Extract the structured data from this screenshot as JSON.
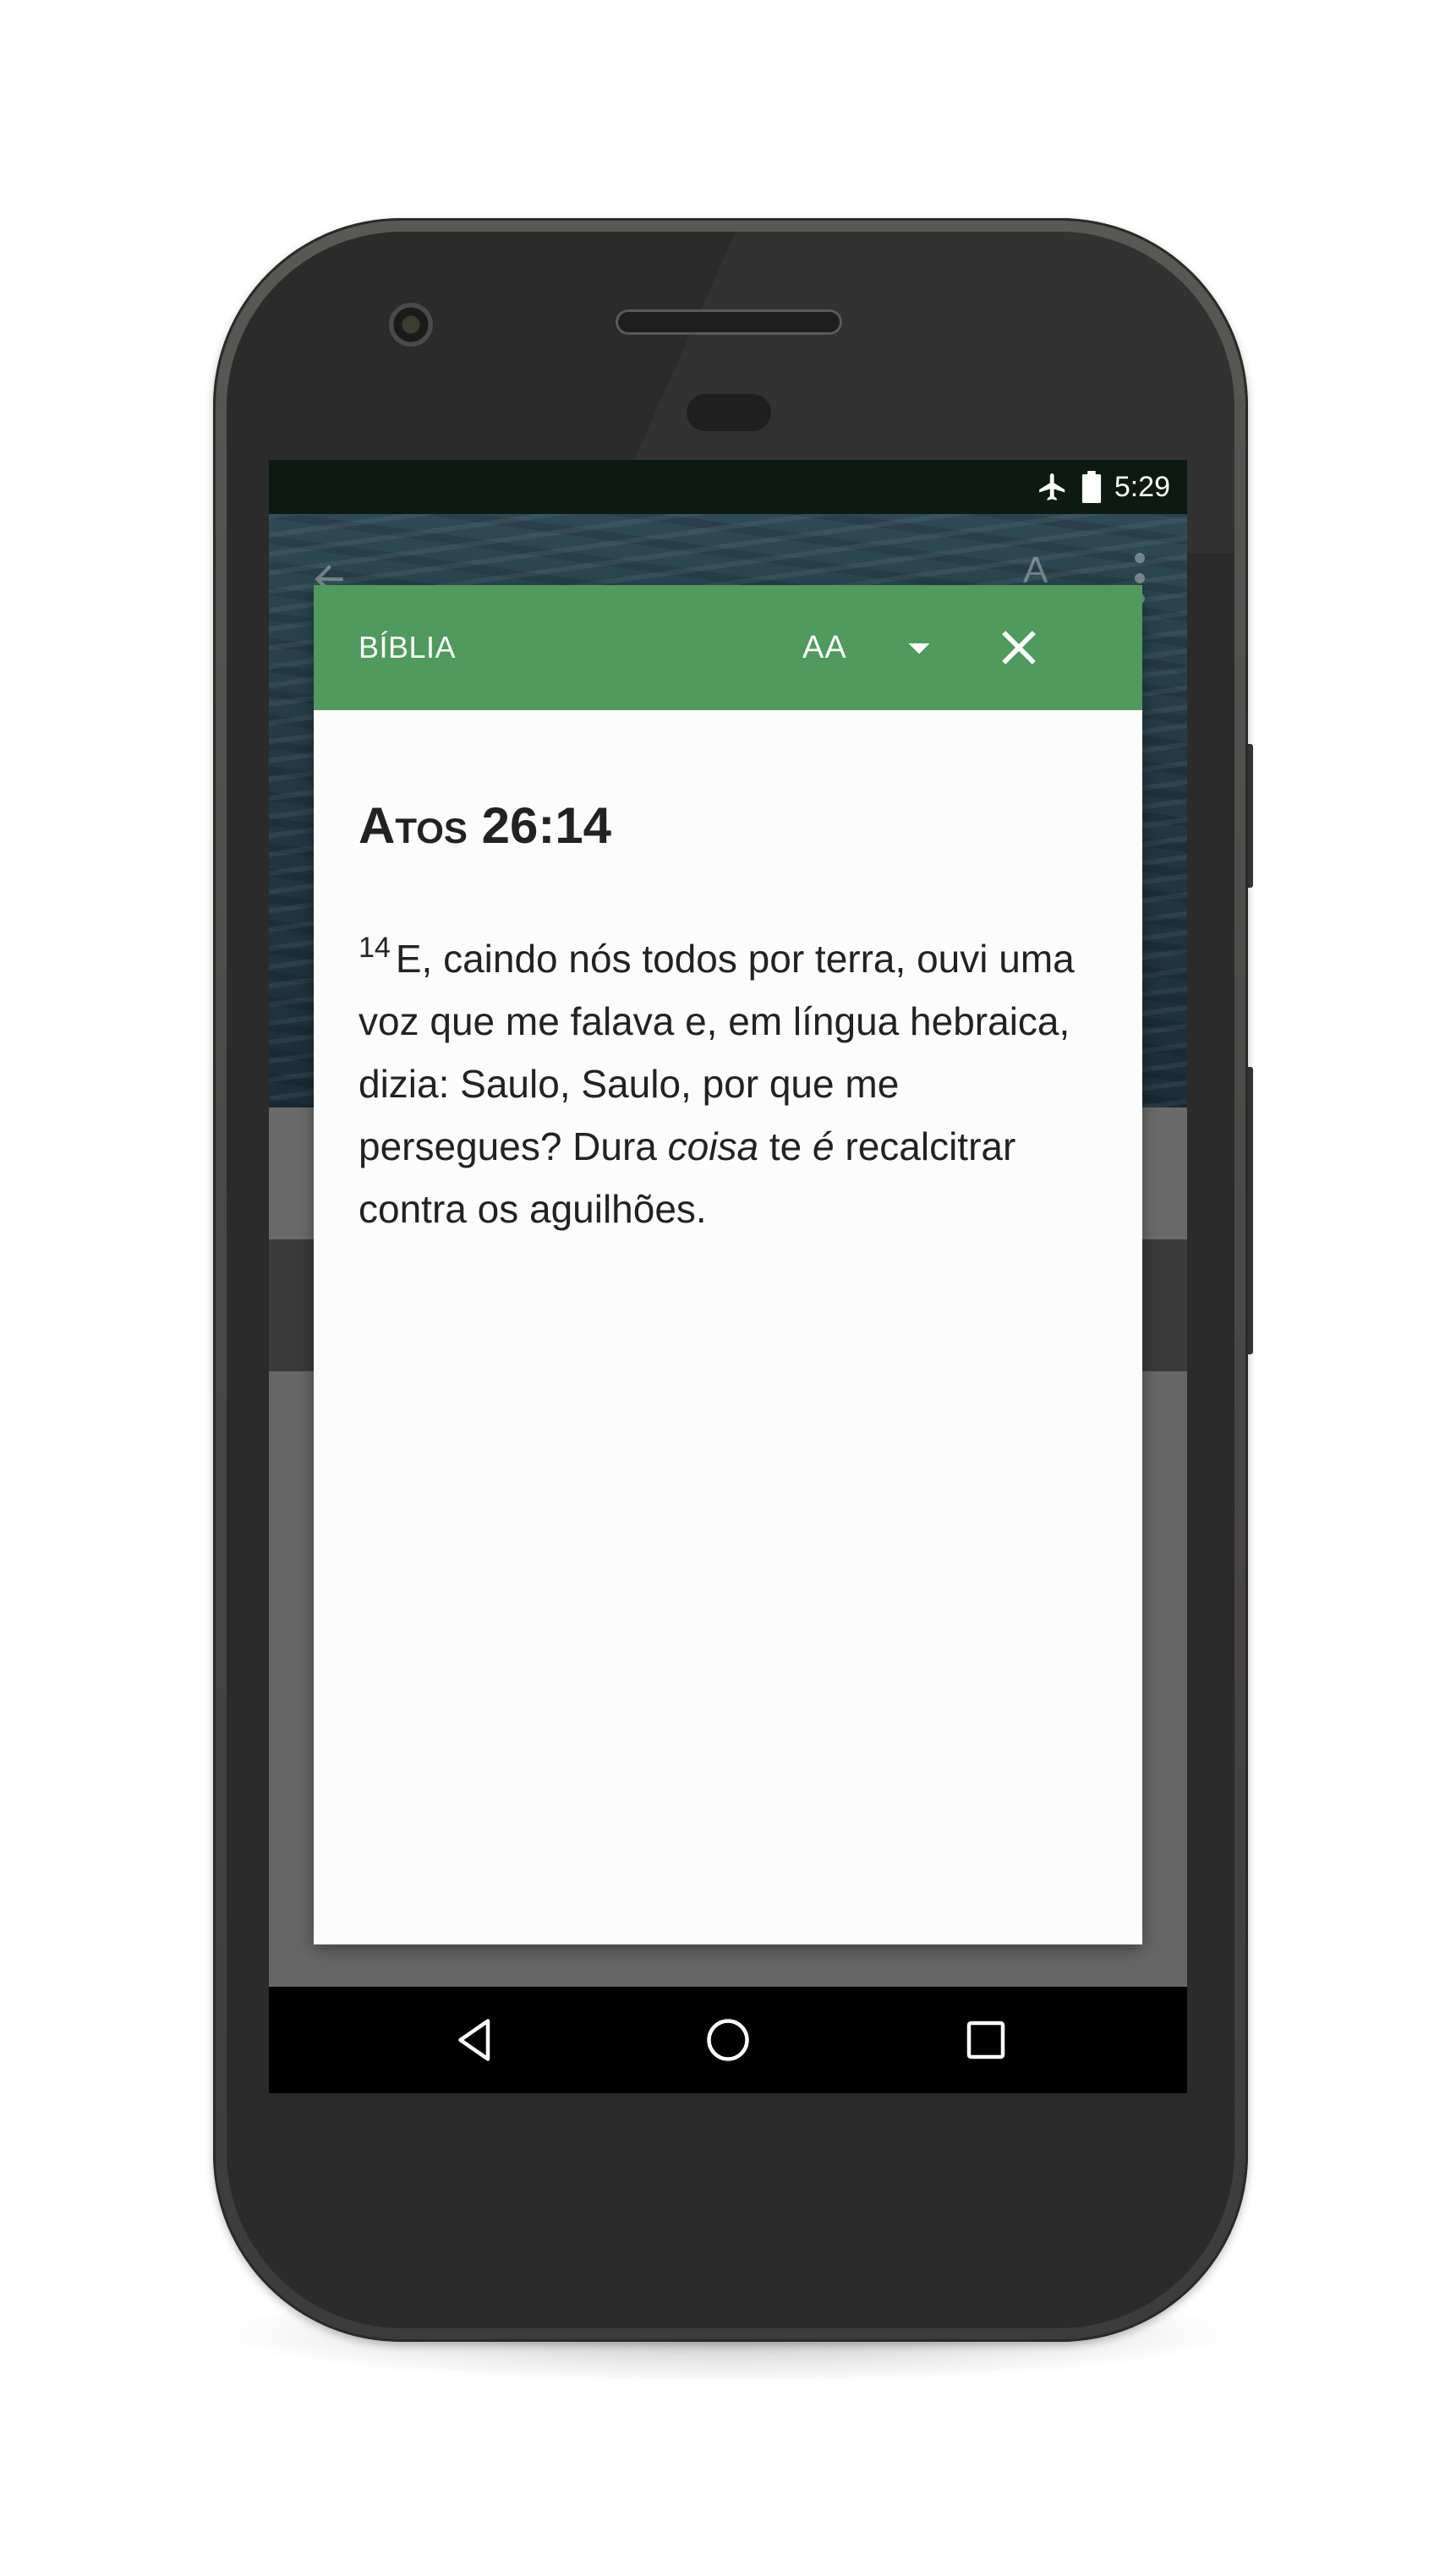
{
  "status_bar": {
    "time": "5:29",
    "icons": [
      "airplane-mode-icon",
      "battery-icon"
    ]
  },
  "app_bar": {
    "icons": [
      "back-arrow-icon",
      "font-icon",
      "more-vert-icon"
    ],
    "font_glyph": "A"
  },
  "dialog": {
    "title": "BÍBLIA",
    "font_size_label": "AA",
    "icons": [
      "dropdown-arrow-icon",
      "close-icon"
    ],
    "reference_book": "Atos",
    "reference_chapter_verse": "26:14",
    "verse_number": "14",
    "verse_parts": [
      "E, caindo nós todos por terra, ouvi uma voz que me falava e, em língua hebraica, dizia: Saulo, Saulo, por que me persegues? Dura ",
      "coisa",
      " te ",
      "é",
      " recalcitrar contra os aguilhões."
    ]
  },
  "nav_bar": {
    "icons": [
      "nav-back-icon",
      "nav-home-icon",
      "nav-recents-icon"
    ]
  },
  "colors": {
    "header_green": "#4f9a5c",
    "status_bar": "#0c1a12",
    "nav_bar": "#000000",
    "dialog_bg": "#fcfcfc",
    "text": "#222222"
  }
}
